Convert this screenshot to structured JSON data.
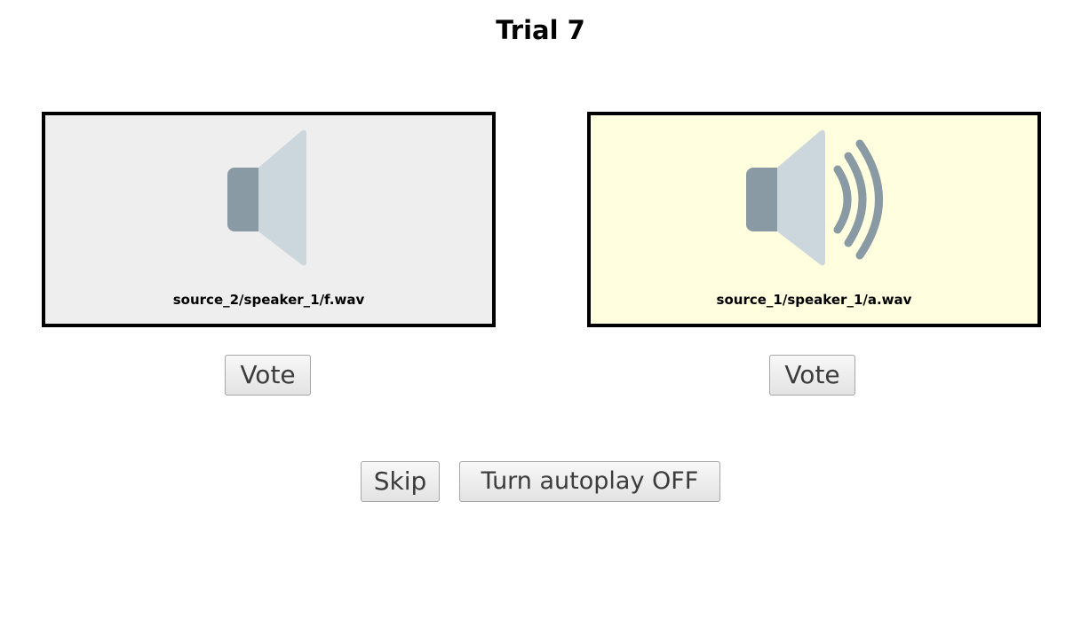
{
  "title": "Trial 7",
  "samples": [
    {
      "file": "source_2/speaker_1/f.wav",
      "icon": "speaker-muted-icon",
      "background": "#eeeeee",
      "playing": false
    },
    {
      "file": "source_1/speaker_1/a.wav",
      "icon": "speaker-playing-icon",
      "background": "#ffffdf",
      "playing": true
    }
  ],
  "vote_label_left": "Vote",
  "vote_label_right": "Vote",
  "skip_label": "Skip",
  "autoplay_label": "Turn autoplay OFF"
}
